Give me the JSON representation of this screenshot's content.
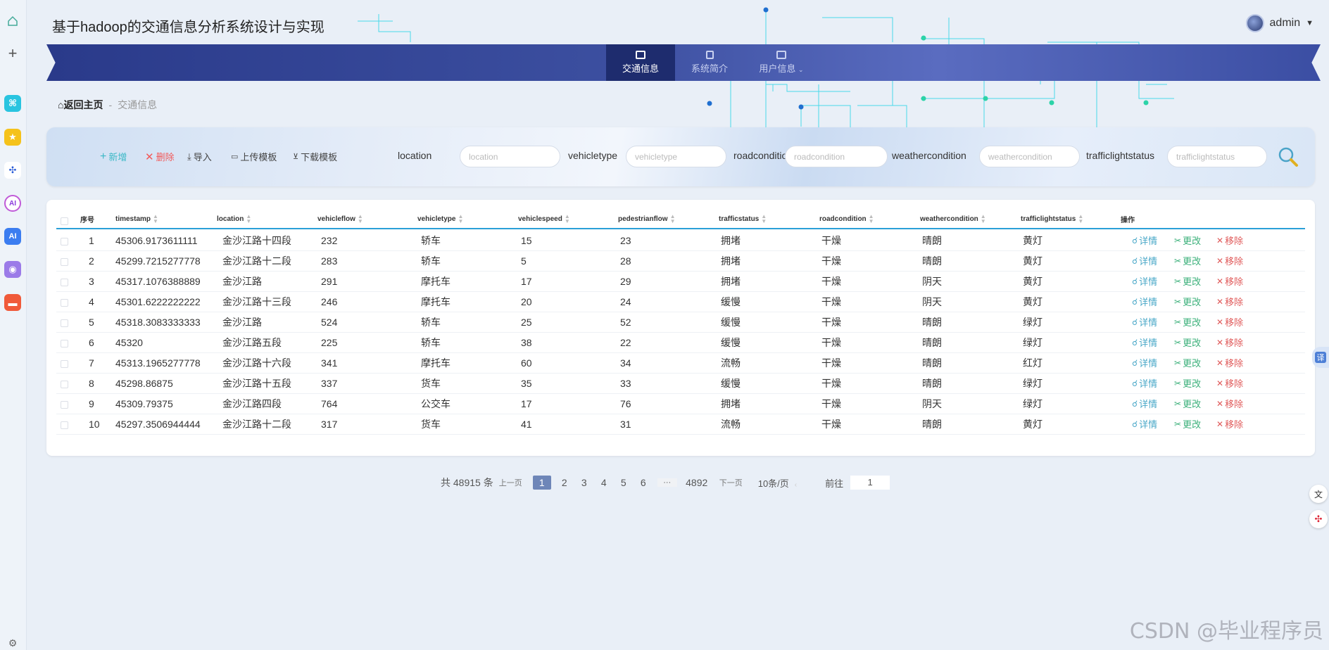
{
  "app": {
    "title": "基于hadoop的交通信息分析系统设计与实现",
    "username": "admin"
  },
  "nav": {
    "items": [
      {
        "label": "交通信息"
      },
      {
        "label": "系统简介"
      },
      {
        "label": "用户信息"
      }
    ]
  },
  "breadcrumb": {
    "home": "返回主页",
    "separator": "-",
    "current": "交通信息"
  },
  "toolbar": {
    "add": "新增",
    "delete": "删除",
    "import": "导入",
    "upload_template": "上传模板",
    "download_template": "下载模板",
    "filters": [
      {
        "label": "location",
        "placeholder": "location"
      },
      {
        "label": "vehicletype",
        "placeholder": "vehicletype"
      },
      {
        "label": "roadcondition",
        "placeholder": "roadcondition"
      },
      {
        "label": "weathercondition",
        "placeholder": "weathercondition"
      },
      {
        "label": "trafficlightstatus",
        "placeholder": "trafficlightstatus"
      }
    ]
  },
  "table": {
    "headers": [
      "序号",
      "timestamp",
      "location",
      "vehicleflow",
      "vehicletype",
      "vehiclespeed",
      "pedestrianflow",
      "trafficstatus",
      "roadcondition",
      "weathercondition",
      "trafficlightstatus",
      "操作"
    ],
    "actions": {
      "detail": "详情",
      "edit": "更改",
      "remove": "移除"
    },
    "rows": [
      [
        "1",
        "45306.9173611111",
        "金沙江路十四段",
        "232",
        "轿车",
        "15",
        "23",
        "拥堵",
        "干燥",
        "晴朗",
        "黄灯"
      ],
      [
        "2",
        "45299.7215277778",
        "金沙江路十二段",
        "283",
        "轿车",
        "5",
        "28",
        "拥堵",
        "干燥",
        "晴朗",
        "黄灯"
      ],
      [
        "3",
        "45317.1076388889",
        "金沙江路",
        "291",
        "摩托车",
        "17",
        "29",
        "拥堵",
        "干燥",
        "阴天",
        "黄灯"
      ],
      [
        "4",
        "45301.6222222222",
        "金沙江路十三段",
        "246",
        "摩托车",
        "20",
        "24",
        "缓慢",
        "干燥",
        "阴天",
        "黄灯"
      ],
      [
        "5",
        "45318.3083333333",
        "金沙江路",
        "524",
        "轿车",
        "25",
        "52",
        "缓慢",
        "干燥",
        "晴朗",
        "绿灯"
      ],
      [
        "6",
        "45320",
        "金沙江路五段",
        "225",
        "轿车",
        "38",
        "22",
        "缓慢",
        "干燥",
        "晴朗",
        "绿灯"
      ],
      [
        "7",
        "45313.1965277778",
        "金沙江路十六段",
        "341",
        "摩托车",
        "60",
        "34",
        "流畅",
        "干燥",
        "晴朗",
        "红灯"
      ],
      [
        "8",
        "45298.86875",
        "金沙江路十五段",
        "337",
        "货车",
        "35",
        "33",
        "缓慢",
        "干燥",
        "晴朗",
        "绿灯"
      ],
      [
        "9",
        "45309.79375",
        "金沙江路四段",
        "764",
        "公交车",
        "17",
        "76",
        "拥堵",
        "干燥",
        "阴天",
        "绿灯"
      ],
      [
        "10",
        "45297.3506944444",
        "金沙江路十二段",
        "317",
        "货车",
        "41",
        "31",
        "流畅",
        "干燥",
        "晴朗",
        "黄灯"
      ]
    ]
  },
  "pagination": {
    "total": "共 48915 条",
    "prev": "上一页",
    "pages": [
      "1",
      "2",
      "3",
      "4",
      "5",
      "6"
    ],
    "ellipsis": "···",
    "last": "4892",
    "next": "下一页",
    "page_size": "10条/页",
    "goto_label": "前往",
    "goto_value": "1"
  },
  "side_widgets": {
    "translate": "译"
  },
  "watermark": "CSDN @毕业程序员",
  "colors": {
    "nav": "#2f3f8f",
    "accent": "#2b9fd8",
    "add": "#3bb8c6",
    "delete": "#f25a5a",
    "edit": "#3bb07a",
    "remove": "#e05a5a"
  }
}
